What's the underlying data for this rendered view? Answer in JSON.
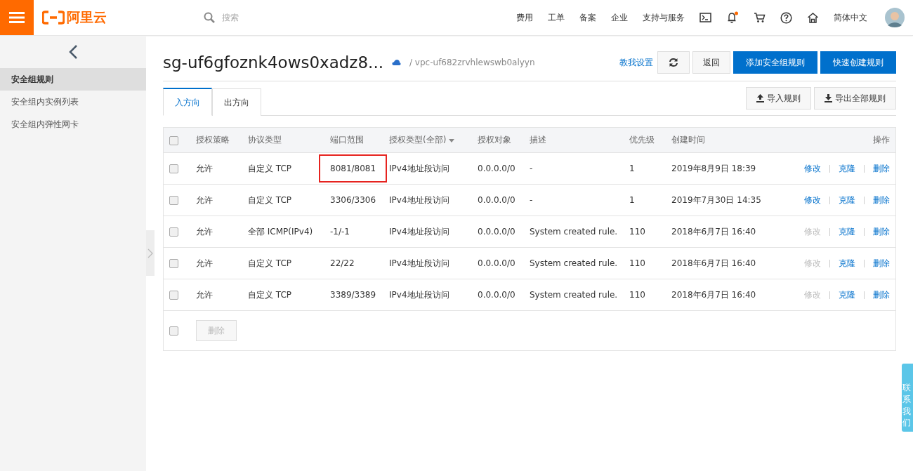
{
  "topbar": {
    "logo": "阿里云",
    "search": {
      "placeholder": "搜索"
    },
    "nav": [
      "费用",
      "工单",
      "备案",
      "企业",
      "支持与服务"
    ],
    "notification_dot": true,
    "language": "简体中文"
  },
  "sidebar": {
    "items": [
      {
        "label": "安全组规则",
        "selected": true
      },
      {
        "label": "安全组内实例列表",
        "selected": false
      },
      {
        "label": "安全组内弹性网卡",
        "selected": false
      }
    ]
  },
  "page": {
    "title": "sg-uf6gfoznk4ows0xadz8...",
    "vpc": "/ vpc-uf682zrvhlewswb0alyyn",
    "help_link": "教我设置",
    "back": "返回",
    "add_rule": "添加安全组规则",
    "quick_create": "快速创建规则"
  },
  "tabs": [
    {
      "label": "入方向",
      "selected": true
    },
    {
      "label": "出方向",
      "selected": false
    }
  ],
  "import": "导入规则",
  "export": "导出全部规则",
  "table": {
    "columns": [
      "授权策略",
      "协议类型",
      "端口范围",
      "授权类型(全部)",
      "授权对象",
      "描述",
      "优先级",
      "创建时间",
      "操作"
    ],
    "rows": [
      {
        "checked": false,
        "policy": "允许",
        "protocol": "自定义 TCP",
        "port": "8081/8081",
        "port_highlighted": true,
        "auth_type": "IPv4地址段访问",
        "target": "0.0.0.0/0",
        "description": "-",
        "priority": "1",
        "created": "2019年8月9日 18:39",
        "edit": "修改",
        "edit_disabled": false,
        "clone": "克隆",
        "delete": "删除"
      },
      {
        "checked": false,
        "policy": "允许",
        "protocol": "自定义 TCP",
        "port": "3306/3306",
        "port_highlighted": false,
        "auth_type": "IPv4地址段访问",
        "target": "0.0.0.0/0",
        "description": "-",
        "priority": "1",
        "created": "2019年7月30日 14:35",
        "edit": "修改",
        "edit_disabled": false,
        "clone": "克隆",
        "delete": "删除"
      },
      {
        "checked": false,
        "policy": "允许",
        "protocol": "全部 ICMP(IPv4)",
        "port": "-1/-1",
        "port_highlighted": false,
        "auth_type": "IPv4地址段访问",
        "target": "0.0.0.0/0",
        "description": "System created rule.",
        "priority": "110",
        "created": "2018年6月7日 16:40",
        "edit": "修改",
        "edit_disabled": true,
        "clone": "克隆",
        "delete": "删除"
      },
      {
        "checked": false,
        "policy": "允许",
        "protocol": "自定义 TCP",
        "port": "22/22",
        "port_highlighted": false,
        "auth_type": "IPv4地址段访问",
        "target": "0.0.0.0/0",
        "description": "System created rule.",
        "priority": "110",
        "created": "2018年6月7日 16:40",
        "edit": "修改",
        "edit_disabled": true,
        "clone": "克隆",
        "delete": "删除"
      },
      {
        "checked": false,
        "policy": "允许",
        "protocol": "自定义 TCP",
        "port": "3389/3389",
        "port_highlighted": false,
        "auth_type": "IPv4地址段访问",
        "target": "0.0.0.0/0",
        "description": "System created rule.",
        "priority": "110",
        "created": "2018年6月7日 16:40",
        "edit": "修改",
        "edit_disabled": true,
        "clone": "克隆",
        "delete": "删除"
      }
    ],
    "select_all_checked": false,
    "footer_checked": false,
    "delete_button": "删除",
    "delete_disabled": true
  },
  "contact": "联系我们"
}
